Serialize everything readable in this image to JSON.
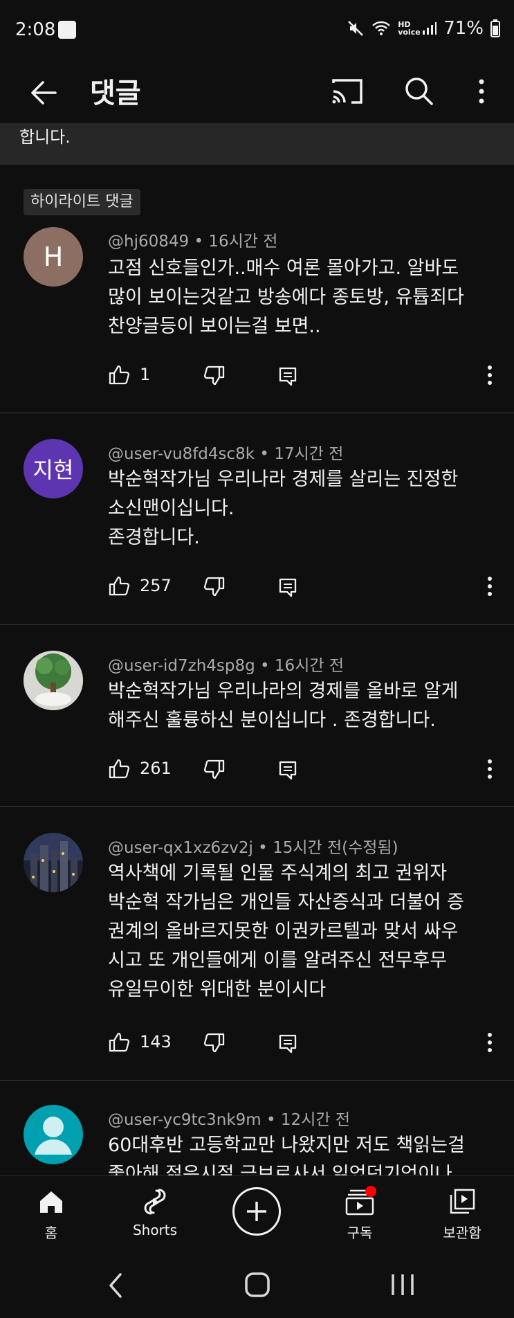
{
  "status": {
    "time": "2:08",
    "battery": "71%",
    "network": "HD voice"
  },
  "header": {
    "title": "댓글"
  },
  "pinned_preview": {
    "text": "합니다."
  },
  "highlight_label": "하이라이트 댓글",
  "comments": [
    {
      "handle": "@hj60849",
      "time": "16시간 전",
      "avatar_letter": "H",
      "lines": [
        "고점 신호들인가..매수 여론 몰아가고. 알바도",
        "많이 보이는것같고 방송에다 종토방, 유튭죄다",
        "찬양글등이 보이는걸 보면.."
      ],
      "likes": "1"
    },
    {
      "handle": "@user-vu8fd4sc8k",
      "time": "17시간 전",
      "avatar_letter": "지현",
      "lines": [
        "박순혁작가님 우리나라 경제를 살리는 진정한",
        "소신맨이십니다.",
        "존경합니다."
      ],
      "likes": "257"
    },
    {
      "handle": "@user-id7zh4sp8g",
      "time": "16시간 전",
      "avatar_letter": "",
      "lines": [
        "박순혁작가님 우리나라의 경제를 올바로 알게",
        "해주신 훌륭하신 분이십니다 . 존경합니다."
      ],
      "likes": "261"
    },
    {
      "handle": "@user-qx1xz6zv2j",
      "time": "15시간 전(수정됨)",
      "avatar_letter": "",
      "lines": [
        "역사책에 기록될 인물 주식계의 최고 권위자",
        "박순혁 작가님은 개인들 자산증식과 더불어 증",
        "권계의 올바르지못한 이권카르텔과 맞서 싸우",
        "시고 또 개인들에게 이를 알려주신 전무후무",
        "유일무이한 위대한 분이시다"
      ],
      "likes": "143"
    },
    {
      "handle": "@user-yc9tc3nk9m",
      "time": "12시간 전",
      "avatar_letter": "",
      "lines": [
        "60대후반 고등학교만 나왔지만 저도 책읽는걸",
        "좋아해 젊은시절 금브로사서 읽었던기억이나"
      ],
      "likes": ""
    }
  ],
  "bottom_nav": {
    "home": "홈",
    "shorts": "Shorts",
    "subscriptions": "구독",
    "library": "보관함"
  },
  "colors": {
    "background": "#0f0f0f",
    "notification_dot": "#ff0000",
    "avatar_h": "#8d6e63",
    "avatar_jihyun": "#5e35b1",
    "avatar_default": "#00a0b0"
  }
}
